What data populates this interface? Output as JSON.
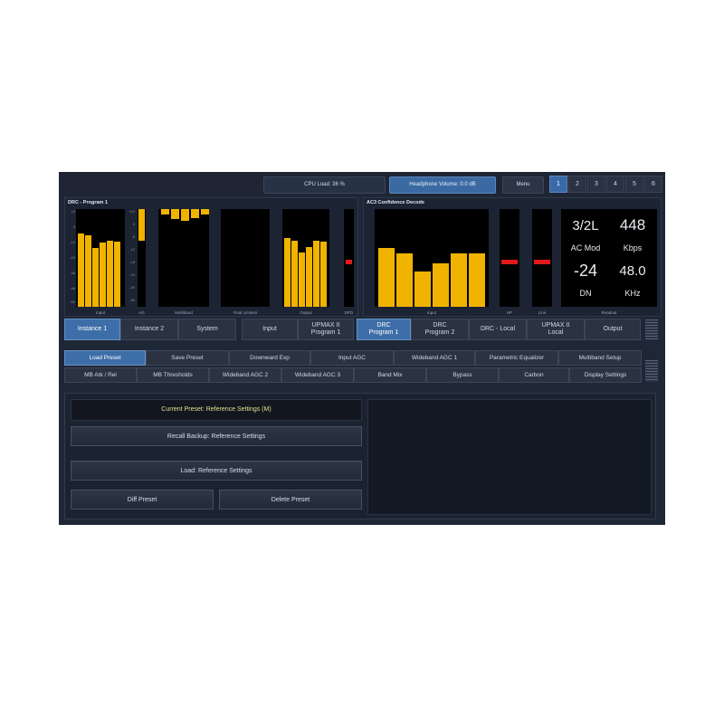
{
  "topbar": {
    "cpu_load": "CPU Load: 36 %",
    "headphone_volume": "Headphone Volume: 0.0 dB",
    "menu": "Menu",
    "pages": [
      "1",
      "2",
      "3",
      "4",
      "5",
      "6"
    ],
    "active_page": "1"
  },
  "left_panel": {
    "title": "DRC - Program 1",
    "scale_values": [
      "12",
      "0",
      "-12",
      "-24",
      "-36",
      "-48",
      "-60"
    ],
    "agc_scale": [
      "+12",
      "0",
      "-6",
      "-12",
      "-18",
      "-24",
      "-30",
      "-36"
    ],
    "meter_labels": [
      "Input",
      "AG",
      "Multiband",
      "Final Limiters",
      "Output",
      "DPD"
    ],
    "input_levels": [
      0.75,
      0.73,
      0.6,
      0.66,
      0.68,
      0.67
    ],
    "ag_level": 0.32,
    "multiband_levels": [
      0.06,
      0.1,
      0.12,
      0.09,
      0.06
    ],
    "output_levels": [
      0.7,
      0.68,
      0.56,
      0.61,
      0.68,
      0.67
    ]
  },
  "right_panel": {
    "title": "AC3 Confidence Decode",
    "meter_labels": [
      "Input",
      "HP",
      "Line",
      "Readout"
    ],
    "input_levels": [
      0.6,
      0.55,
      0.36,
      0.44,
      0.55,
      0.55
    ],
    "readout": {
      "channels": "3/2L",
      "bitrate": "448",
      "mode": "AC Mod",
      "bitrate_unit": "Kbps",
      "dialnorm": "-24",
      "dialnorm_label": "DN",
      "sample_rate": "48.0",
      "sample_rate_unit": "KHz"
    }
  },
  "nav_row": {
    "items": [
      {
        "label": "Instance 1",
        "active": true
      },
      {
        "label": "Instance 2",
        "active": false
      },
      {
        "label": "System",
        "active": false
      },
      {
        "label": "Input",
        "active": false
      },
      {
        "label": "UPMAX II\nProgram 1",
        "active": false
      },
      {
        "label": "DRC\nProgram 1",
        "active": true
      },
      {
        "label": "DRC\nProgram 2",
        "active": false
      },
      {
        "label": "DRC - Local",
        "active": false
      },
      {
        "label": "UPMAX II\nLocal",
        "active": false
      },
      {
        "label": "Output",
        "active": false
      }
    ]
  },
  "sub_row1": {
    "items": [
      {
        "label": "Load Preset",
        "active": true
      },
      {
        "label": "Save Preset",
        "active": false
      },
      {
        "label": "Downward Exp",
        "active": false
      },
      {
        "label": "Input AGC",
        "active": false
      },
      {
        "label": "Wideband AGC 1",
        "active": false
      },
      {
        "label": "Parametric Equalizer",
        "active": false
      },
      {
        "label": "Multiband Setup",
        "active": false
      }
    ]
  },
  "sub_row2": {
    "items": [
      {
        "label": "MB Atk / Rel"
      },
      {
        "label": "MB Thresholds"
      },
      {
        "label": "Wideband AGC 2"
      },
      {
        "label": "Wideband AGC 3"
      },
      {
        "label": "Band Mix"
      },
      {
        "label": "Bypass"
      },
      {
        "label": "Carbon"
      },
      {
        "label": "Display Settings"
      }
    ]
  },
  "content": {
    "current_preset": "Current Preset: Reference Settings (M)",
    "recall_backup": "Recall Backup: Reference Settings",
    "load": "Load: Reference Settings",
    "diff_preset": "Diff Preset",
    "delete_preset": "Delete Preset"
  },
  "colors": {
    "meter": "#f0b400",
    "peak": "#e01a1a",
    "active_tab": "#3e6ea8",
    "background": "#1e2736"
  }
}
